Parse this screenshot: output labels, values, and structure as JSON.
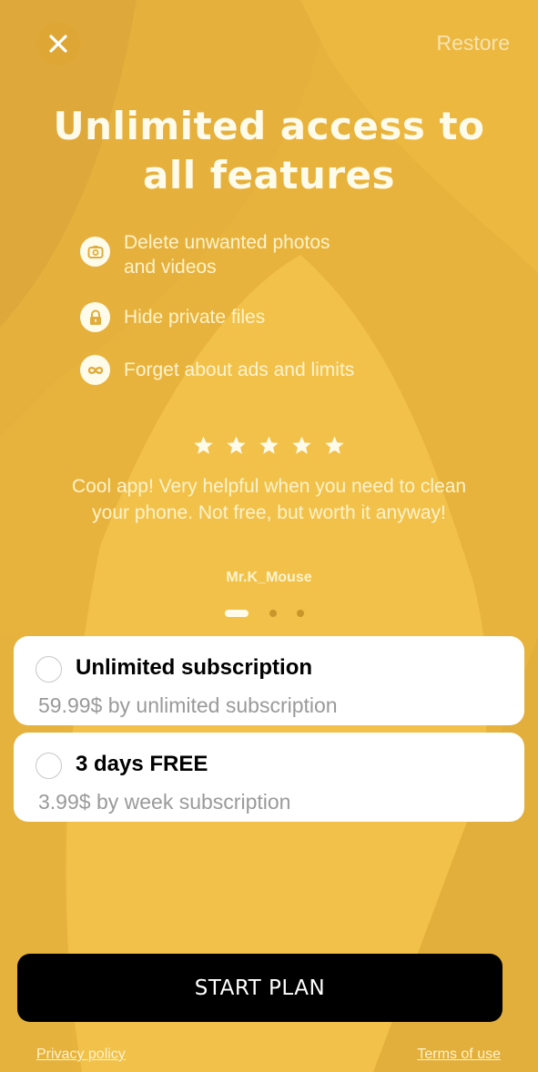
{
  "header": {
    "close_icon": "close-icon",
    "restore_label": "Restore"
  },
  "title": {
    "line1": "Unlimited access to",
    "line2": "all features"
  },
  "features": [
    {
      "icon": "camera-icon",
      "label_line1": "Delete unwanted photos",
      "label_line2": "and videos"
    },
    {
      "icon": "lock-icon",
      "label": "Hide private files"
    },
    {
      "icon": "infinity-icon",
      "label": "Forget about ads and limits"
    }
  ],
  "review": {
    "rating": 5,
    "rating_max": 5,
    "text": "Cool app! Very helpful when you need to clean your phone. Not free, but worth it anyway!",
    "author": "Mr.K_Mouse",
    "carousel_pages": 3,
    "carousel_active_index": 0
  },
  "plans": [
    {
      "name": "Unlimited subscription",
      "price": "59.99$ by unlimited subscription",
      "selected": false
    },
    {
      "name": "3 days FREE",
      "price": "3.99$ by week subscription",
      "selected": false
    }
  ],
  "cta": {
    "label": "START PLAN"
  },
  "footer": {
    "privacy_label": "Privacy policy",
    "terms_label": "Terms of use"
  },
  "colors": {
    "background": "#e8b33c",
    "background_light": "#f2c14a",
    "background_dark": "#dfa83a",
    "card": "#ffffff",
    "cta": "#000000",
    "text_light": "#fff3cc"
  }
}
